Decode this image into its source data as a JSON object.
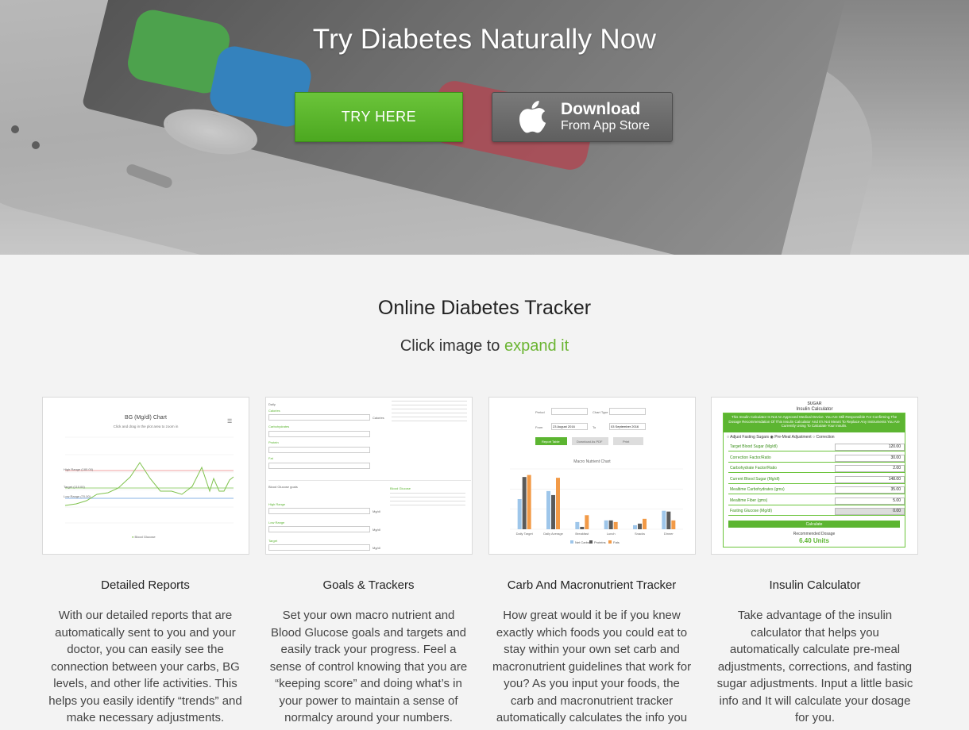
{
  "hero": {
    "title": "Try Diabetes Naturally Now",
    "try_button": "TRY HERE",
    "app_store_line1": "Download",
    "app_store_line2": "From App Store"
  },
  "section": {
    "title": "Online Diabetes Tracker",
    "subtitle_prefix": "Click image to ",
    "subtitle_link": "expand it"
  },
  "features": [
    {
      "title": "Detailed Reports",
      "text": "With our detailed reports that are automatically sent to you and your doctor, you can easily see the connection between your carbs, BG levels, and other life activities. This helps you easily identify “trends” and make necessary adjustments."
    },
    {
      "title": "Goals & Trackers",
      "text": "Set your own macro nutrient and Blood Glucose goals and targets and easily track your progress. Feel a sense of control knowing that you are “keeping score” and doing what’s in your power to maintain a sense of normalcy around your numbers."
    },
    {
      "title": "Carb And Macronutrient Tracker",
      "text": "How great would it be if you knew exactly which foods you could eat to stay within your own set carb and macronutrient guidelines that work for you? As you input your foods, the carb and macronutrient tracker automatically calculates the info you"
    },
    {
      "title": "Insulin Calculator",
      "text": "Take advantage of the insulin calculator that helps you automatically calculate pre-meal adjustments, corrections, and fasting sugar adjustments. Input a little basic info and It will calculate your dosage for you."
    }
  ],
  "thumb_bg": {
    "title": "BG (Mg/dl) Chart",
    "subtitle": "Click and drag in the plot area to zoom in",
    "high": "High Range (180.00)",
    "target": "Target (110.00)",
    "low": "Low Range (70.00)",
    "legend": "Blood Glucose"
  },
  "thumb_goals": {
    "daily": "Daily",
    "calories": "Calories",
    "carbs": "Carbohydrates",
    "protein": "Protein",
    "fat": "Fat",
    "bg_goals": "Blood Glucose goals",
    "high_range": "High Range",
    "low_range": "Low Range",
    "target": "Target",
    "unit": "Mg/dl",
    "bg_side": "Blood Glucose"
  },
  "thumb_macro": {
    "period": "Period",
    "chart_type": "Chart Type",
    "from": "From",
    "to": "To",
    "from_val": "23 August 2016",
    "to_val": "03 September 2016",
    "report_table": "Report Table",
    "download_pdf": "Download As PDF",
    "print": "Print",
    "chart_title": "Macro Nutrient Chart",
    "series": [
      "Net Carbs",
      "Proteins",
      "Fats"
    ],
    "categories": [
      "Daily Target",
      "Daily Average",
      "Breakfast",
      "Lunch",
      "Snacks",
      "Dinner"
    ],
    "net_carbs": [
      75,
      95,
      18,
      22,
      10,
      46
    ],
    "proteins": [
      130,
      85,
      6,
      22,
      14,
      44
    ],
    "fats": [
      135,
      128,
      35,
      18,
      26,
      22
    ],
    "ymax": 150
  },
  "thumb_insulin": {
    "logo": "SUGAR",
    "title": "Insulin Calculator",
    "disclaimer": "This Insulin Calculator Is Not An Approved Medical Device. You Are Still Responsible For Confirming The Dosage Recommendation Of This Insulin Calculator And It's Not Meant To Replace Any Instruments You Are Currently Using To Calculate Your Insulin.",
    "option_fasting": "Adjust Fasting Sugars",
    "option_premeal": "Pre-Meal Adjustment",
    "option_correction": "Correction",
    "rows": [
      {
        "label": "Target Blood Sugar (Mg/dl)",
        "value": "120.00"
      },
      {
        "label": "Correction Factor/Ratio",
        "value": "30.00"
      },
      {
        "label": "Carbohydrate Factor/Ratio",
        "value": "2.00"
      },
      {
        "label": "Current Blood Sugar (Mg/dl)",
        "value": "148.00"
      },
      {
        "label": "Mealtime Carbohydrates (gms)",
        "value": "35.00"
      },
      {
        "label": "Mealtime Fiber (gms)",
        "value": "5.00"
      },
      {
        "label": "Fasting Glucose (Mg/dl)",
        "value": "0.00"
      }
    ],
    "calculate": "Calculate",
    "recommended": "Recommended Dosage",
    "result": "6.40 Units"
  },
  "colors": {
    "accent_green": "#6ab431",
    "try_button": "#5cb531",
    "app_store_button": "#6a6a6a"
  }
}
